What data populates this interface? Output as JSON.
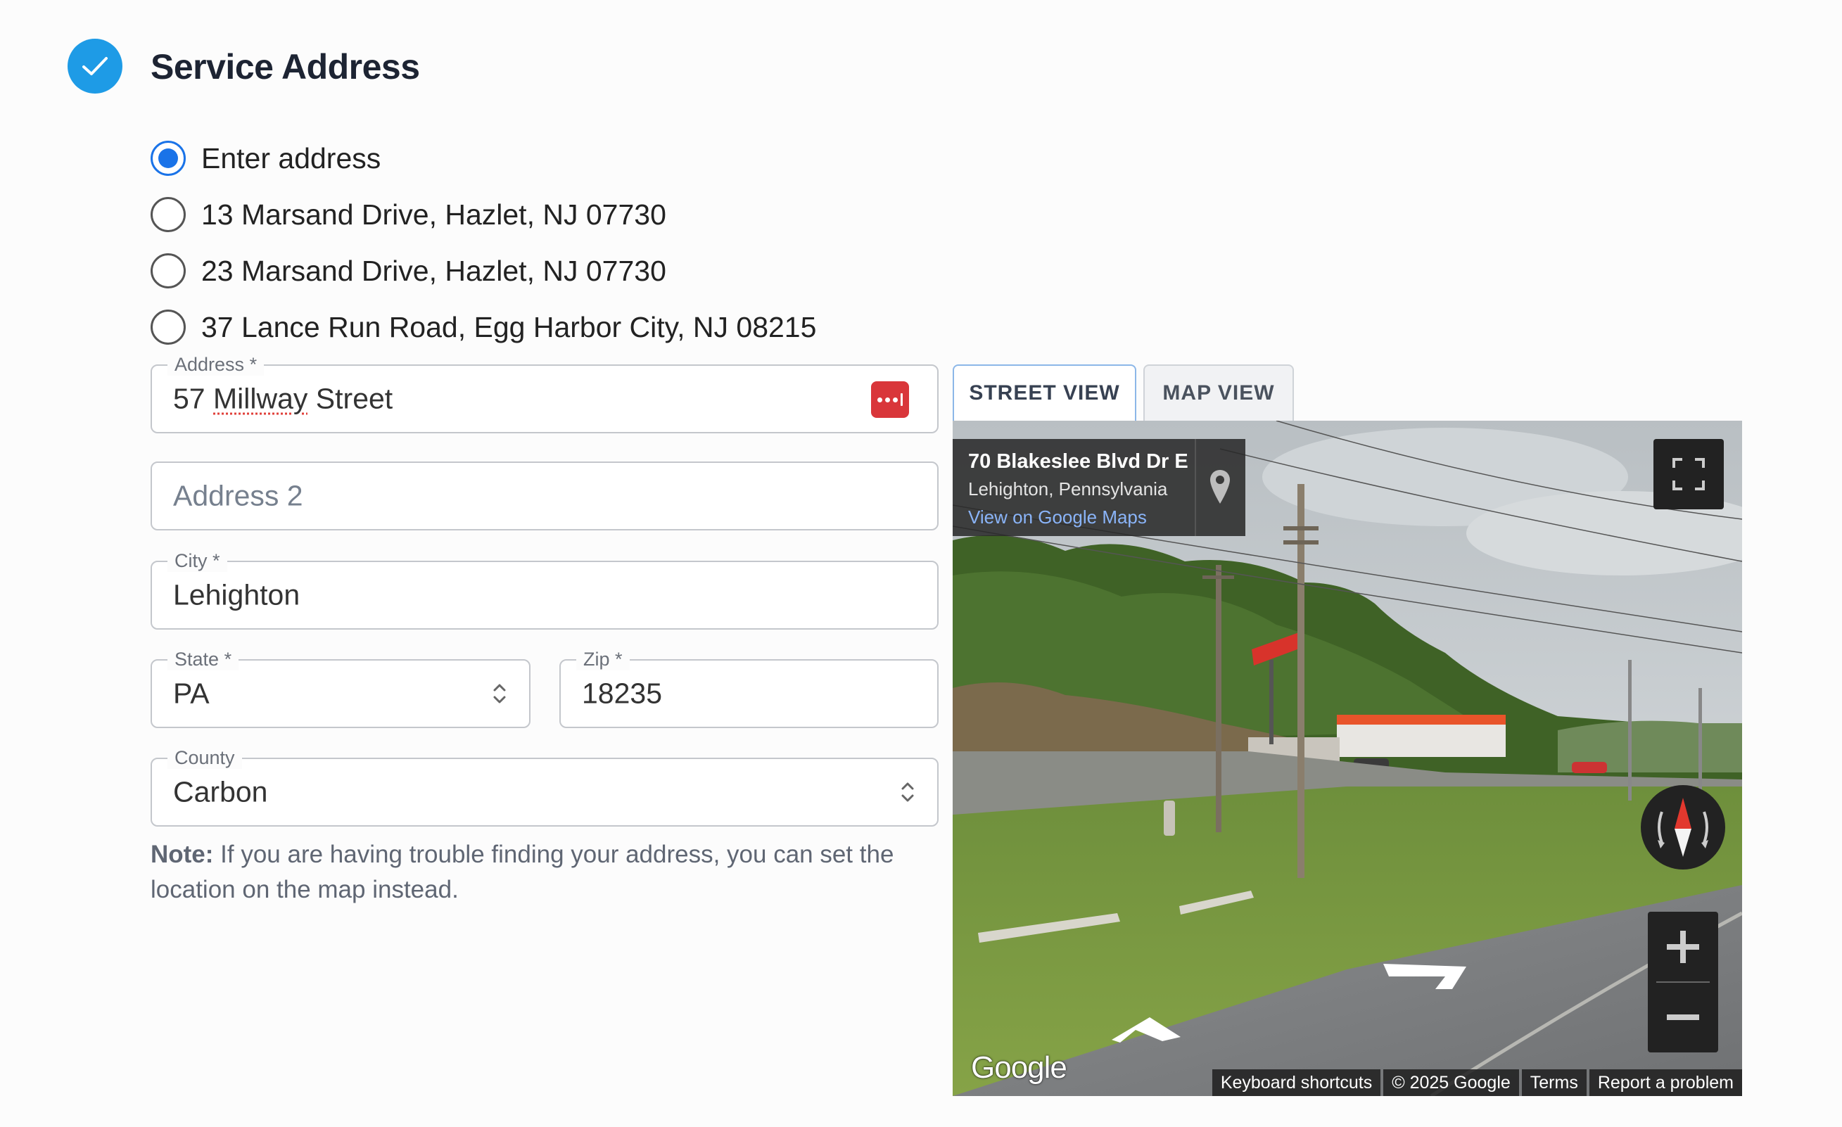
{
  "section": {
    "title": "Service Address"
  },
  "address_options": [
    {
      "label": "Enter address",
      "selected": true
    },
    {
      "label": "13 Marsand Drive, Hazlet, NJ 07730",
      "selected": false
    },
    {
      "label": "23 Marsand Drive, Hazlet, NJ 07730",
      "selected": false
    },
    {
      "label": "37 Lance Run Road, Egg Harbor City, NJ 08215",
      "selected": false
    }
  ],
  "form": {
    "address": {
      "label": "Address",
      "required_mark": "*",
      "value_prefix": "57 ",
      "value_misspelled": "Millway",
      "value_suffix": " Street"
    },
    "address2": {
      "placeholder": "Address 2"
    },
    "city": {
      "label": "City",
      "required_mark": "*",
      "value": "Lehighton"
    },
    "state": {
      "label": "State",
      "required_mark": "*",
      "value": "PA"
    },
    "zip": {
      "label": "Zip",
      "required_mark": "*",
      "value": "18235"
    },
    "county": {
      "label": "County",
      "value": "Carbon"
    }
  },
  "note": {
    "bold": "Note:",
    "text": " If you are having trouble finding your address, you can set the location on the map instead."
  },
  "tabs": [
    {
      "label": "STREET VIEW",
      "active": true
    },
    {
      "label": "MAP VIEW",
      "active": false
    }
  ],
  "street_view": {
    "place_title": "70 Blakeslee Blvd Dr E",
    "place_subtitle": "Lehighton, Pennsylvania",
    "maps_link": "View on Google Maps",
    "logo": "Google",
    "footer": [
      "Keyboard shortcuts",
      "© 2025 Google",
      "Terms",
      "Report a problem"
    ],
    "icons": [
      "pin-icon",
      "fullscreen-icon",
      "compass-icon",
      "zoom-in-icon",
      "zoom-out-icon"
    ]
  },
  "colors": {
    "accent": "#1a73e8",
    "check": "#1e9be6",
    "password_manager": "#d9363a"
  }
}
